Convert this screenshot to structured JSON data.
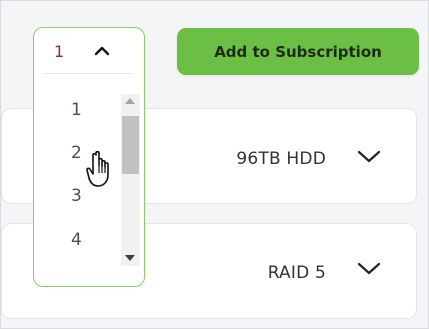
{
  "dropdown": {
    "selected": "1",
    "options": [
      "1",
      "2",
      "3",
      "4"
    ]
  },
  "button": {
    "label": "Add to Subscription",
    "color": "#6cbf45"
  },
  "cards": [
    {
      "value": "96TB HDD"
    },
    {
      "value": "RAID 5"
    }
  ],
  "icons": {
    "dropdown_toggle": "chevron-up-icon",
    "card_expand": "chevron-down-icon",
    "cursor": "hand-pointer-icon"
  },
  "colors": {
    "accent": "#6cbf45",
    "dropdown_border": "#86cf68",
    "selected_text": "#8a2f2a"
  }
}
